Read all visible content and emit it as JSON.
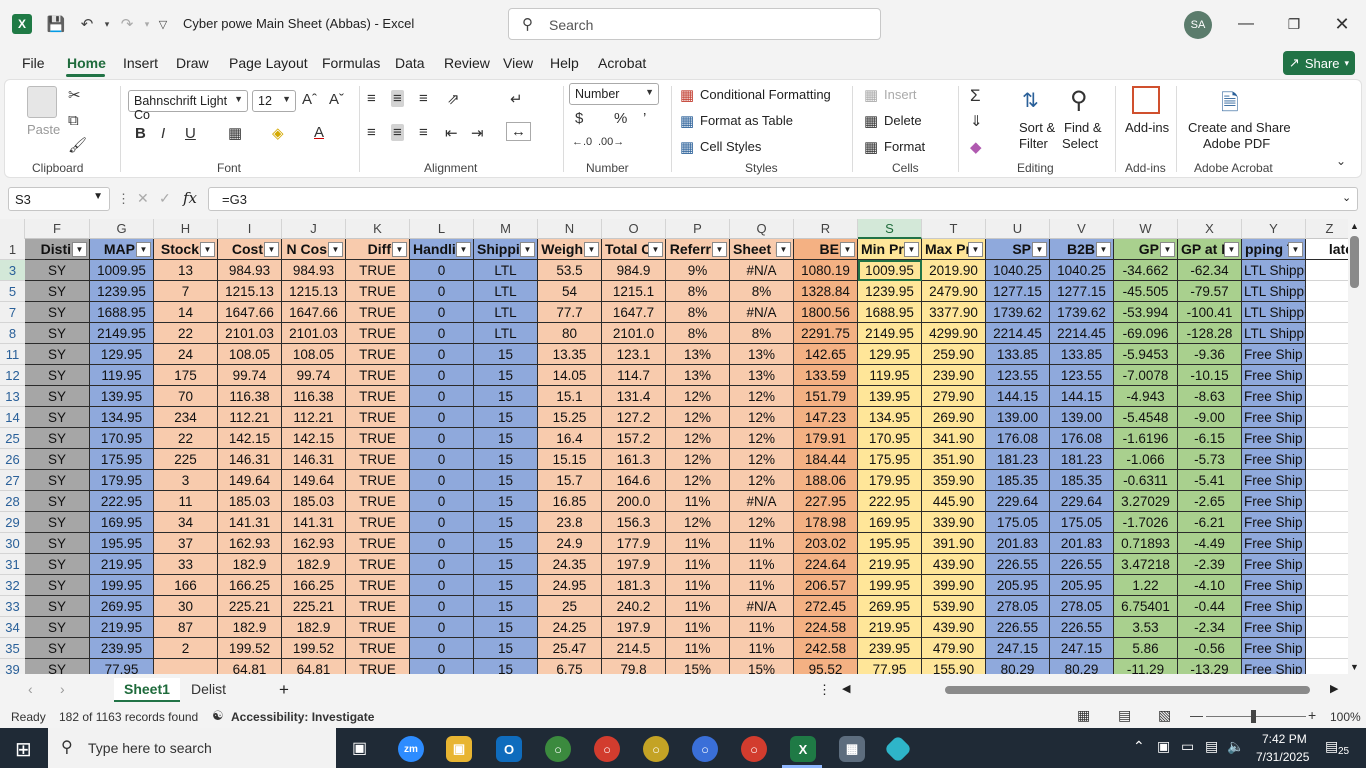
{
  "window": {
    "title": "Cyber powe Main Sheet (Abbas)  -  Excel",
    "search_placeholder": "Search",
    "avatar": "SA"
  },
  "menu": {
    "items": [
      "File",
      "Home",
      "Insert",
      "Draw",
      "Page Layout",
      "Formulas",
      "Data",
      "Review",
      "View",
      "Help",
      "Acrobat"
    ],
    "share": "Share"
  },
  "ribbon": {
    "clipboard": {
      "paste": "Paste",
      "label": "Clipboard"
    },
    "font": {
      "name": "Bahnschrift Light Co",
      "size": "12",
      "label": "Font"
    },
    "alignment": {
      "label": "Alignment"
    },
    "number": {
      "format": "Number",
      "label": "Number"
    },
    "styles": {
      "conditional": "Conditional Formatting",
      "table": "Format as Table",
      "cell": "Cell Styles",
      "label": "Styles"
    },
    "cells": {
      "insert": "Insert",
      "delete": "Delete",
      "format": "Format",
      "label": "Cells"
    },
    "editing": {
      "sort": "Sort &",
      "filter": "Filter",
      "find": "Find &",
      "select": "Select",
      "label": "Editing"
    },
    "addins": {
      "btn": "Add-ins",
      "label": "Add-ins"
    },
    "acrobat": {
      "line1": "Create and Share",
      "line2": "Adobe PDF",
      "label": "Adobe Acrobat"
    }
  },
  "formula_bar": {
    "name_box": "S3",
    "formula": "=G3"
  },
  "sheet": {
    "columns": [
      "F",
      "G",
      "H",
      "I",
      "J",
      "K",
      "L",
      "M",
      "N",
      "O",
      "P",
      "Q",
      "R",
      "S",
      "T",
      "U",
      "V",
      "W",
      "X",
      "Y",
      "Z"
    ],
    "headers": [
      "Disti",
      "MAP",
      "Stock",
      "Cost",
      "N Cos",
      "Diff",
      "Handli",
      "Shippi",
      "Weigh",
      "Total C",
      "Referr",
      "Sheet R",
      "BE",
      "Min Pri",
      "Max Pri",
      "SP",
      "B2B",
      "GP",
      "GP at M",
      "pping Te",
      "late"
    ],
    "rows": [
      {
        "n": "3",
        "v": [
          "SY",
          "1009.95",
          "13",
          "984.93",
          "984.93",
          "TRUE",
          "0",
          "LTL",
          "53.5",
          "984.9",
          "9%",
          "#N/A",
          "1080.19",
          "1009.95",
          "2019.90",
          "1040.25",
          "1040.25",
          "-34.662",
          "-62.34",
          "LTL Shipping",
          ""
        ]
      },
      {
        "n": "5",
        "v": [
          "SY",
          "1239.95",
          "7",
          "1215.13",
          "1215.13",
          "TRUE",
          "0",
          "LTL",
          "54",
          "1215.1",
          "8%",
          "8%",
          "1328.84",
          "1239.95",
          "2479.90",
          "1277.15",
          "1277.15",
          "-45.505",
          "-79.57",
          "LTL Shipping",
          ""
        ]
      },
      {
        "n": "7",
        "v": [
          "SY",
          "1688.95",
          "14",
          "1647.66",
          "1647.66",
          "TRUE",
          "0",
          "LTL",
          "77.7",
          "1647.7",
          "8%",
          "#N/A",
          "1800.56",
          "1688.95",
          "3377.90",
          "1739.62",
          "1739.62",
          "-53.994",
          "-100.41",
          "LTL Shipping",
          ""
        ]
      },
      {
        "n": "8",
        "v": [
          "SY",
          "2149.95",
          "22",
          "2101.03",
          "2101.03",
          "TRUE",
          "0",
          "LTL",
          "80",
          "2101.0",
          "8%",
          "8%",
          "2291.75",
          "2149.95",
          "4299.90",
          "2214.45",
          "2214.45",
          "-69.096",
          "-128.28",
          "LTL Shipping",
          ""
        ]
      },
      {
        "n": "11",
        "v": [
          "SY",
          "129.95",
          "24",
          "108.05",
          "108.05",
          "TRUE",
          "0",
          "15",
          "13.35",
          "123.1",
          "13%",
          "13%",
          "142.65",
          "129.95",
          "259.90",
          "133.85",
          "133.85",
          "-5.9453",
          "-9.36",
          "Free Ship (Be",
          ""
        ]
      },
      {
        "n": "12",
        "v": [
          "SY",
          "119.95",
          "175",
          "99.74",
          "99.74",
          "TRUE",
          "0",
          "15",
          "14.05",
          "114.7",
          "13%",
          "13%",
          "133.59",
          "119.95",
          "239.90",
          "123.55",
          "123.55",
          "-7.0078",
          "-10.15",
          "Free Ship (Be",
          ""
        ]
      },
      {
        "n": "13",
        "v": [
          "SY",
          "139.95",
          "70",
          "116.38",
          "116.38",
          "TRUE",
          "0",
          "15",
          "15.1",
          "131.4",
          "12%",
          "12%",
          "151.79",
          "139.95",
          "279.90",
          "144.15",
          "144.15",
          "-4.943",
          "-8.63",
          "Free Ship (Be",
          ""
        ]
      },
      {
        "n": "14",
        "v": [
          "SY",
          "134.95",
          "234",
          "112.21",
          "112.21",
          "TRUE",
          "0",
          "15",
          "15.25",
          "127.2",
          "12%",
          "12%",
          "147.23",
          "134.95",
          "269.90",
          "139.00",
          "139.00",
          "-5.4548",
          "-9.00",
          "Free Ship (Be",
          ""
        ]
      },
      {
        "n": "25",
        "v": [
          "SY",
          "170.95",
          "22",
          "142.15",
          "142.15",
          "TRUE",
          "0",
          "15",
          "16.4",
          "157.2",
          "12%",
          "12%",
          "179.91",
          "170.95",
          "341.90",
          "176.08",
          "176.08",
          "-1.6196",
          "-6.15",
          "Free Ship (Be",
          ""
        ]
      },
      {
        "n": "26",
        "v": [
          "SY",
          "175.95",
          "225",
          "146.31",
          "146.31",
          "TRUE",
          "0",
          "15",
          "15.15",
          "161.3",
          "12%",
          "12%",
          "184.44",
          "175.95",
          "351.90",
          "181.23",
          "181.23",
          "-1.066",
          "-5.73",
          "Free Ship (Be",
          ""
        ]
      },
      {
        "n": "27",
        "v": [
          "SY",
          "179.95",
          "3",
          "149.64",
          "149.64",
          "TRUE",
          "0",
          "15",
          "15.7",
          "164.6",
          "12%",
          "12%",
          "188.06",
          "179.95",
          "359.90",
          "185.35",
          "185.35",
          "-0.6311",
          "-5.41",
          "Free Ship (Be",
          ""
        ]
      },
      {
        "n": "28",
        "v": [
          "SY",
          "222.95",
          "11",
          "185.03",
          "185.03",
          "TRUE",
          "0",
          "15",
          "16.85",
          "200.0",
          "11%",
          "#N/A",
          "227.95",
          "222.95",
          "445.90",
          "229.64",
          "229.64",
          "3.27029",
          "-2.65",
          "Free Ship (Be",
          ""
        ]
      },
      {
        "n": "29",
        "v": [
          "SY",
          "169.95",
          "34",
          "141.31",
          "141.31",
          "TRUE",
          "0",
          "15",
          "23.8",
          "156.3",
          "12%",
          "12%",
          "178.98",
          "169.95",
          "339.90",
          "175.05",
          "175.05",
          "-1.7026",
          "-6.21",
          "Free Ship (Be",
          ""
        ]
      },
      {
        "n": "30",
        "v": [
          "SY",
          "195.95",
          "37",
          "162.93",
          "162.93",
          "TRUE",
          "0",
          "15",
          "24.9",
          "177.9",
          "11%",
          "11%",
          "203.02",
          "195.95",
          "391.90",
          "201.83",
          "201.83",
          "0.71893",
          "-4.49",
          "Free Ship (Be",
          ""
        ]
      },
      {
        "n": "31",
        "v": [
          "SY",
          "219.95",
          "33",
          "182.9",
          "182.9",
          "TRUE",
          "0",
          "15",
          "24.35",
          "197.9",
          "11%",
          "11%",
          "224.64",
          "219.95",
          "439.90",
          "226.55",
          "226.55",
          "3.47218",
          "-2.39",
          "Free Ship (Be",
          ""
        ]
      },
      {
        "n": "32",
        "v": [
          "SY",
          "199.95",
          "166",
          "166.25",
          "166.25",
          "TRUE",
          "0",
          "15",
          "24.95",
          "181.3",
          "11%",
          "11%",
          "206.57",
          "199.95",
          "399.90",
          "205.95",
          "205.95",
          "1.22",
          "-4.10",
          "Free Ship (Be",
          ""
        ]
      },
      {
        "n": "33",
        "v": [
          "SY",
          "269.95",
          "30",
          "225.21",
          "225.21",
          "TRUE",
          "0",
          "15",
          "25",
          "240.2",
          "11%",
          "#N/A",
          "272.45",
          "269.95",
          "539.90",
          "278.05",
          "278.05",
          "6.75401",
          "-0.44",
          "Free Ship (Be",
          ""
        ]
      },
      {
        "n": "34",
        "v": [
          "SY",
          "219.95",
          "87",
          "182.9",
          "182.9",
          "TRUE",
          "0",
          "15",
          "24.25",
          "197.9",
          "11%",
          "11%",
          "224.58",
          "219.95",
          "439.90",
          "226.55",
          "226.55",
          "3.53",
          "-2.34",
          "Free Ship (Be",
          ""
        ]
      },
      {
        "n": "35",
        "v": [
          "SY",
          "239.95",
          "2",
          "199.52",
          "199.52",
          "TRUE",
          "0",
          "15",
          "25.47",
          "214.5",
          "11%",
          "11%",
          "242.58",
          "239.95",
          "479.90",
          "247.15",
          "247.15",
          "5.86",
          "-0.56",
          "Free Ship (Be",
          ""
        ]
      },
      {
        "n": "39",
        "v": [
          "SY",
          "77.95",
          "",
          "64.81",
          "64.81",
          "TRUE",
          "0",
          "15",
          "6.75",
          "79.8",
          "15%",
          "15%",
          "95.52",
          "77.95",
          "155.90",
          "80.29",
          "80.29",
          "-11.29",
          "-13.29",
          "Free Ship (Be",
          ""
        ]
      }
    ],
    "tabs": [
      "Sheet1",
      "Delist"
    ],
    "selected_cell": "S3",
    "col_colors": [
      "#a6a6a6",
      "#8fa9dc",
      "#f8cbad",
      "#f8cbad",
      "#f8cbad",
      "#f8cbad",
      "#8fa9dc",
      "#8fa9dc",
      "#f8cbad",
      "#f8cbad",
      "#f8cbad",
      "#f8cbad",
      "#f4b183",
      "#ffe699",
      "#ffe699",
      "#8fa9dc",
      "#8fa9dc",
      "#a9d08e",
      "#a9d08e",
      "#8fa9dc",
      "#ffffff"
    ]
  },
  "status": {
    "ready": "Ready",
    "records": "182 of 1163 records found",
    "accessibility": "Accessibility: Investigate",
    "zoom": "100%"
  },
  "taskbar": {
    "search_placeholder": "Type here to search",
    "time": "7:42 PM",
    "date": "7/31/2025",
    "notifications": "25"
  }
}
